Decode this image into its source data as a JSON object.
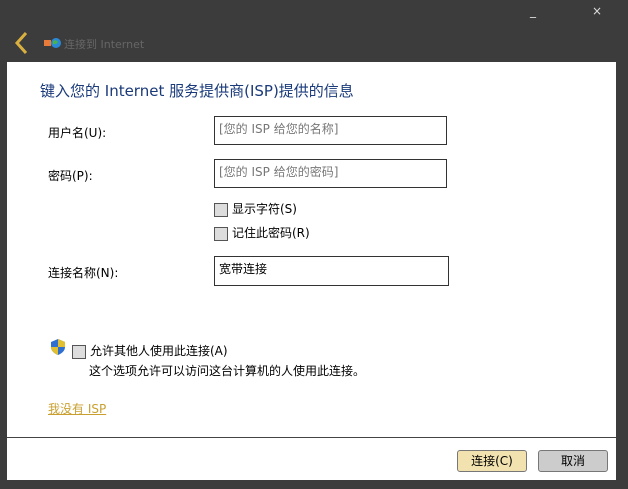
{
  "window": {
    "minimize": "_",
    "close": "×",
    "title": "连接到 Internet"
  },
  "main": {
    "heading": "键入您的 Internet 服务提供商(ISP)提供的信息",
    "username_label": "用户名(U):",
    "username_placeholder": "[您的 ISP 给您的名称]",
    "password_label": "密码(P):",
    "password_placeholder": "[您的 ISP 给您的密码]",
    "show_chars": "显示字符(S)",
    "remember": "记住此密码(R)",
    "conn_name_label": "连接名称(N):",
    "conn_name_value": "宽带连接",
    "allow_others": "允许其他人使用此连接(A)",
    "allow_desc": "这个选项允许可以访问这台计算机的人使用此连接。",
    "no_isp": "我没有 ISP"
  },
  "footer": {
    "connect": "连接(C)",
    "cancel": "取消"
  }
}
